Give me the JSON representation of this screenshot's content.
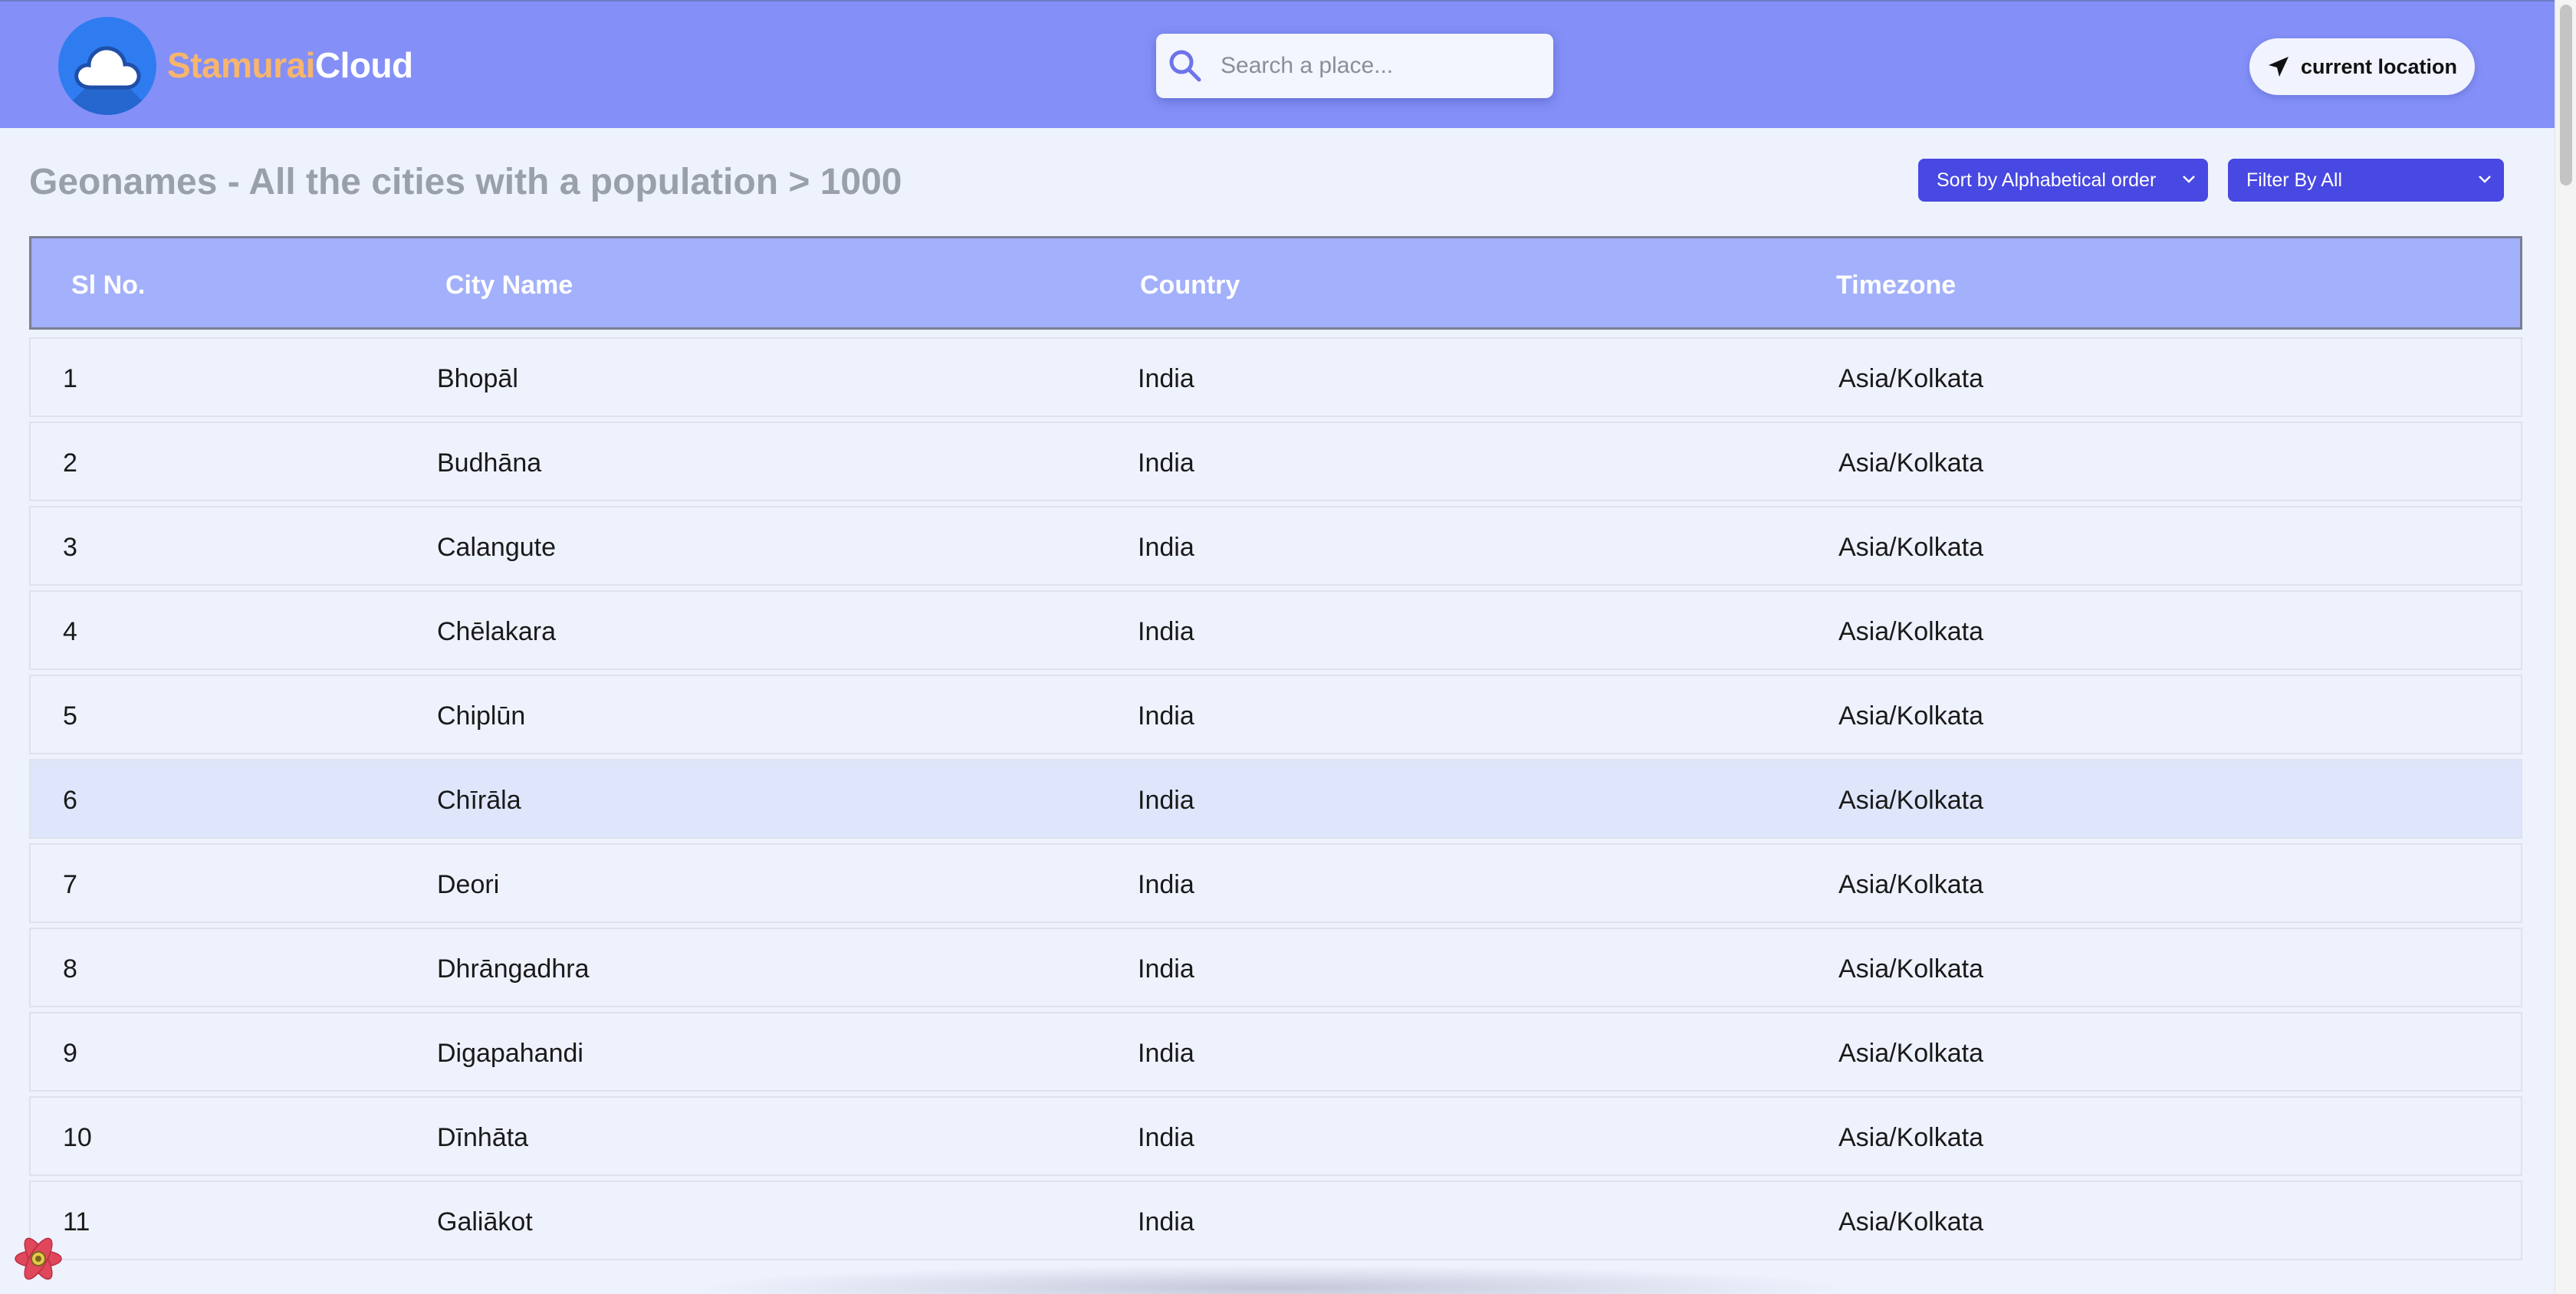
{
  "header": {
    "brand_part1": "Stamurai",
    "brand_part2": "Cloud",
    "search_placeholder": "Search a place...",
    "location_button": "current location"
  },
  "toolbar": {
    "page_title": "Geonames - All the cities with a population > 1000",
    "sort_label": "Sort by Alphabetical order",
    "filter_label": "Filter By All"
  },
  "table": {
    "columns": [
      "Sl No.",
      "City Name",
      "Country",
      "Timezone"
    ],
    "rows": [
      [
        "1",
        "Bhopāl",
        "India",
        "Asia/Kolkata"
      ],
      [
        "2",
        "Budhāna",
        "India",
        "Asia/Kolkata"
      ],
      [
        "3",
        "Calangute",
        "India",
        "Asia/Kolkata"
      ],
      [
        "4",
        "Chēlakara",
        "India",
        "Asia/Kolkata"
      ],
      [
        "5",
        "Chiplūn",
        "India",
        "Asia/Kolkata"
      ],
      [
        "6",
        "Chīrāla",
        "India",
        "Asia/Kolkata"
      ],
      [
        "7",
        "Deori",
        "India",
        "Asia/Kolkata"
      ],
      [
        "8",
        "Dhrāngadhra",
        "India",
        "Asia/Kolkata"
      ],
      [
        "9",
        "Digapahandi",
        "India",
        "Asia/Kolkata"
      ],
      [
        "10",
        "Dīnhāta",
        "India",
        "Asia/Kolkata"
      ],
      [
        "11",
        "Galiākot",
        "India",
        "Asia/Kolkata"
      ]
    ],
    "highlighted_row": 6
  },
  "colors": {
    "header_bg": "#8490f7",
    "accent": "#4848e2",
    "table_header_bg": "#a3b0fb",
    "brand_orange": "#f7b56d"
  },
  "icons": {
    "logo": "cloud-icon",
    "search": "search-icon",
    "location": "navigation-arrow-icon",
    "dev_tool": "react-devtools-icon"
  }
}
